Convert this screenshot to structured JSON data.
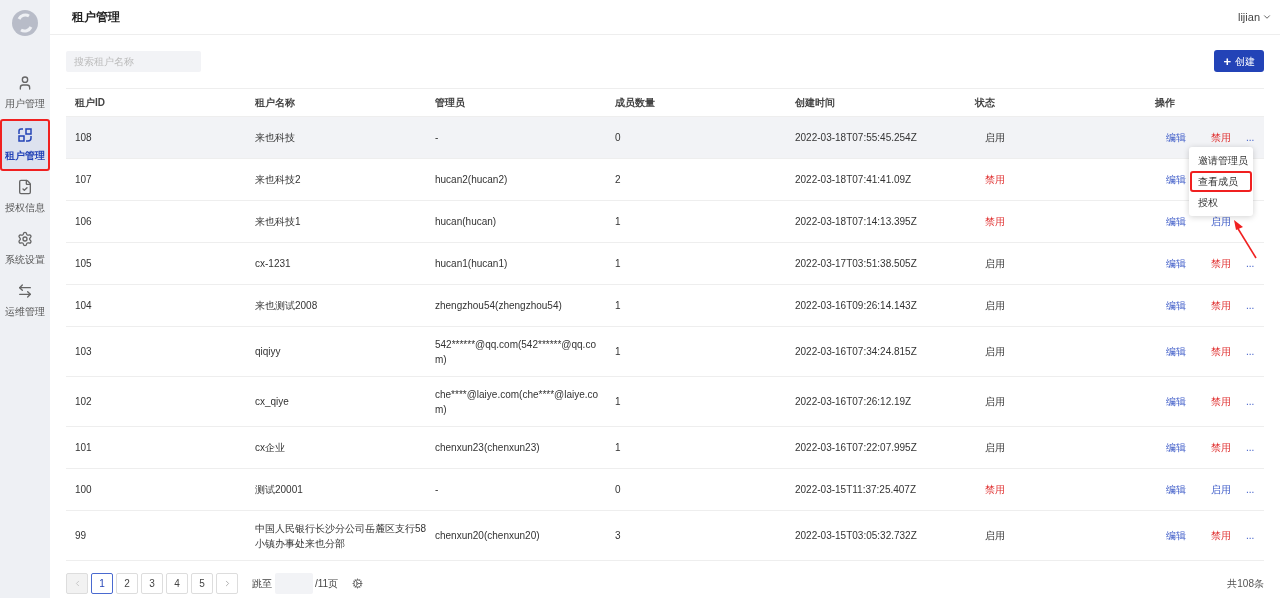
{
  "sidebar": {
    "items": [
      {
        "label": "用户管理",
        "selected": false,
        "annotated": false
      },
      {
        "label": "租户管理",
        "selected": true,
        "annotated": true
      },
      {
        "label": "授权信息",
        "selected": false,
        "annotated": false
      },
      {
        "label": "系统设置",
        "selected": false,
        "annotated": false
      },
      {
        "label": "运维管理",
        "selected": false,
        "annotated": false
      }
    ]
  },
  "header": {
    "title": "租户管理",
    "user": "lijian"
  },
  "search": {
    "placeholder": "搜索租户名称"
  },
  "create_button": {
    "icon": "+",
    "label": "创建"
  },
  "table": {
    "columns": [
      "租户ID",
      "租户名称",
      "管理员",
      "成员数量",
      "创建时间",
      "状态",
      "操作"
    ],
    "rows": [
      {
        "id": "108",
        "name": "来也科技",
        "admin": "-",
        "members": "0",
        "created": "2022-03-18T07:55:45.254Z",
        "status": "启用",
        "enabled": true,
        "hovered": true,
        "edit": "编辑",
        "toggle": "禁用",
        "more": "..."
      },
      {
        "id": "107",
        "name": "来也科技2",
        "admin": "hucan2(hucan2)",
        "members": "2",
        "created": "2022-03-18T07:41:41.09Z",
        "status": "禁用",
        "enabled": false,
        "hovered": false,
        "edit": "编辑"
      },
      {
        "id": "106",
        "name": "来也科技1",
        "admin": "hucan(hucan)",
        "members": "1",
        "created": "2022-03-18T07:14:13.395Z",
        "status": "禁用",
        "enabled": false,
        "hovered": false,
        "edit": "编辑",
        "toggle": "启用"
      },
      {
        "id": "105",
        "name": "cx-1231",
        "admin": "hucan1(hucan1)",
        "members": "1",
        "created": "2022-03-17T03:51:38.505Z",
        "status": "启用",
        "enabled": true,
        "hovered": false,
        "edit": "编辑",
        "toggle": "禁用",
        "more": "..."
      },
      {
        "id": "104",
        "name": "来也测试2008",
        "admin": "zhengzhou54(zhengzhou54)",
        "members": "1",
        "created": "2022-03-16T09:26:14.143Z",
        "status": "启用",
        "enabled": true,
        "hovered": false,
        "edit": "编辑",
        "toggle": "禁用",
        "more": "..."
      },
      {
        "id": "103",
        "name": "qiqiyy",
        "admin": "542******@qq.com(542******@qq.com)",
        "members": "1",
        "created": "2022-03-16T07:34:24.815Z",
        "status": "启用",
        "enabled": true,
        "hovered": false,
        "edit": "编辑",
        "toggle": "禁用",
        "more": "..."
      },
      {
        "id": "102",
        "name": "cx_qiye",
        "admin": "che****@laiye.com(che****@laiye.com)",
        "members": "1",
        "created": "2022-03-16T07:26:12.19Z",
        "status": "启用",
        "enabled": true,
        "hovered": false,
        "edit": "编辑",
        "toggle": "禁用",
        "more": "..."
      },
      {
        "id": "101",
        "name": "cx企业",
        "admin": "chenxun23(chenxun23)",
        "members": "1",
        "created": "2022-03-16T07:22:07.995Z",
        "status": "启用",
        "enabled": true,
        "hovered": false,
        "edit": "编辑",
        "toggle": "禁用",
        "more": "..."
      },
      {
        "id": "100",
        "name": "测试20001",
        "admin": "-",
        "members": "0",
        "created": "2022-03-15T11:37:25.407Z",
        "status": "禁用",
        "enabled": false,
        "hovered": false,
        "edit": "编辑",
        "toggle": "启用",
        "more": "..."
      },
      {
        "id": "99",
        "name": "中国人民银行长沙分公司岳麓区支行58小镇办事处来也分部",
        "admin": "chenxun20(chenxun20)",
        "members": "3",
        "created": "2022-03-15T03:05:32.732Z",
        "status": "启用",
        "enabled": true,
        "hovered": false,
        "edit": "编辑",
        "toggle": "禁用",
        "more": "..."
      }
    ]
  },
  "dropdown_menu": {
    "items": [
      {
        "label": "邀请管理员",
        "annotated": false
      },
      {
        "label": "查看成员",
        "annotated": true
      },
      {
        "label": "授权",
        "annotated": false
      }
    ]
  },
  "pagination": {
    "prev": {
      "disabled": true
    },
    "pages": [
      {
        "label": "1",
        "selected": true
      },
      {
        "label": "2",
        "selected": false
      },
      {
        "label": "3",
        "selected": false
      },
      {
        "label": "4",
        "selected": false
      },
      {
        "label": "5",
        "selected": false
      }
    ],
    "next": {
      "disabled": false
    },
    "jump_label": "跳至",
    "page_count": "/11页",
    "total": "共108条"
  }
}
